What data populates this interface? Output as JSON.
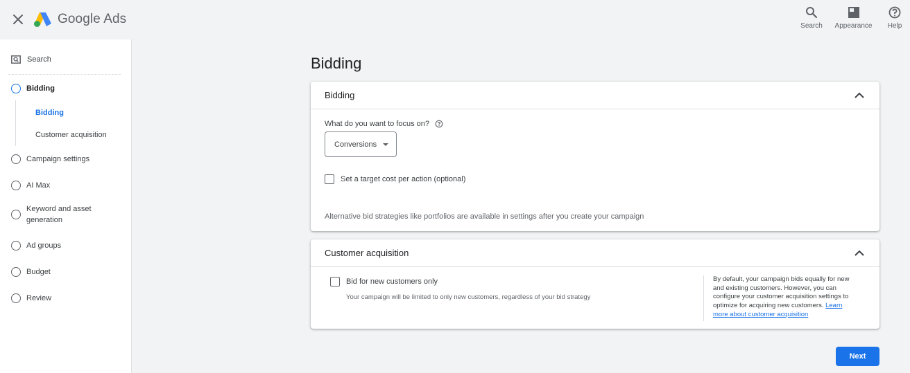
{
  "app": {
    "brand": "Google Ads"
  },
  "topbar": {
    "search_label": "Search",
    "appearance_label": "Appearance",
    "help_label": "Help"
  },
  "sidebar": {
    "search_label": "Search",
    "steps": [
      {
        "label": "Bidding",
        "active": true
      },
      {
        "label": "Campaign settings"
      },
      {
        "label": "AI Max"
      },
      {
        "label": "Keyword and asset generation"
      },
      {
        "label": "Ad groups"
      },
      {
        "label": "Budget"
      },
      {
        "label": "Review"
      }
    ],
    "substeps": [
      {
        "label": "Bidding",
        "active": true
      },
      {
        "label": "Customer acquisition"
      }
    ]
  },
  "main": {
    "page_title": "Bidding",
    "bidding_card": {
      "title": "Bidding",
      "focus_label": "What do you want to focus on?",
      "focus_value": "Conversions",
      "target_cpa_label": "Set a target cost per action (optional)",
      "note": "Alternative bid strategies like portfolios are available in settings after you create your campaign"
    },
    "acquisition_card": {
      "title": "Customer acquisition",
      "checkbox_label": "Bid for new customers only",
      "checkbox_sub": "Your campaign will be limited to only new customers, regardless of your bid strategy",
      "side_text": "By default, your campaign bids equally for new and existing customers. However, you can configure your customer acquisition settings to optimize for acquiring new customers.",
      "side_link": "Learn more about customer acquisition"
    },
    "next_label": "Next"
  },
  "colors": {
    "accent": "#1a73e8",
    "background": "#f1f3f4",
    "surface": "#ffffff"
  },
  "icons": [
    "close-icon",
    "google-ads-logo-icon",
    "search-icon",
    "appearance-icon",
    "help-icon",
    "chevron-up-icon",
    "help-circle-icon",
    "dropdown-caret-icon"
  ]
}
